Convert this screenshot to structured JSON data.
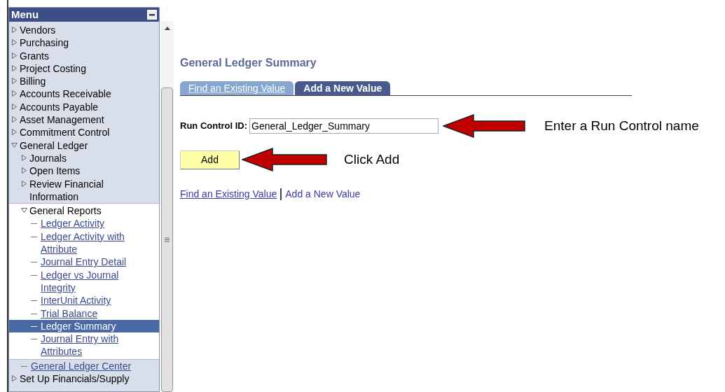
{
  "menu": {
    "title": "Menu",
    "items": [
      {
        "label": "Vendors",
        "kind": "folder",
        "expanded": false
      },
      {
        "label": "Purchasing",
        "kind": "folder",
        "expanded": false
      },
      {
        "label": "Grants",
        "kind": "folder",
        "expanded": false
      },
      {
        "label": "Project Costing",
        "kind": "folder",
        "expanded": false
      },
      {
        "label": "Billing",
        "kind": "folder",
        "expanded": false
      },
      {
        "label": "Accounts Receivable",
        "kind": "folder",
        "expanded": false
      },
      {
        "label": "Accounts Payable",
        "kind": "folder",
        "expanded": false
      },
      {
        "label": "Asset Management",
        "kind": "folder",
        "expanded": false
      },
      {
        "label": "Commitment Control",
        "kind": "folder",
        "expanded": false
      },
      {
        "label": "General Ledger",
        "kind": "folder",
        "expanded": true,
        "children": [
          {
            "label": "Journals",
            "kind": "folder",
            "expanded": false
          },
          {
            "label": "Open Items",
            "kind": "folder",
            "expanded": false
          },
          {
            "label": "Review Financial Information",
            "kind": "folder",
            "expanded": false
          },
          {
            "label": "General Reports",
            "kind": "folder",
            "expanded": true,
            "children": [
              {
                "label": "Ledger Activity",
                "kind": "link",
                "selected": false
              },
              {
                "label": "Ledger Activity with Attribute",
                "kind": "link",
                "selected": false
              },
              {
                "label": "Journal Entry Detail",
                "kind": "link",
                "selected": false
              },
              {
                "label": "Ledger vs Journal Integrity",
                "kind": "link",
                "selected": false
              },
              {
                "label": "InterUnit Activity",
                "kind": "link",
                "selected": false
              },
              {
                "label": "Trial Balance",
                "kind": "link",
                "selected": false
              },
              {
                "label": "Ledger Summary",
                "kind": "link",
                "selected": true
              },
              {
                "label": "Journal Entry with Attributes",
                "kind": "link",
                "selected": false
              }
            ]
          },
          {
            "label": "General Ledger Center",
            "kind": "link",
            "selected": false
          }
        ]
      },
      {
        "label": "Set Up Financials/Supply",
        "kind": "folder",
        "expanded": false
      }
    ]
  },
  "page": {
    "title": "General Ledger Summary",
    "tabs": [
      {
        "label": "Find an Existing Value",
        "selected": false
      },
      {
        "label": "Add a New Value",
        "selected": true
      }
    ],
    "field": {
      "label": "Run Control ID:",
      "value": "General_Ledger_Summary"
    },
    "button": "Add",
    "links": [
      "Find an Existing Value",
      "Add a New Value"
    ]
  },
  "annotations": [
    "Enter a Run Control name",
    "Click Add"
  ]
}
